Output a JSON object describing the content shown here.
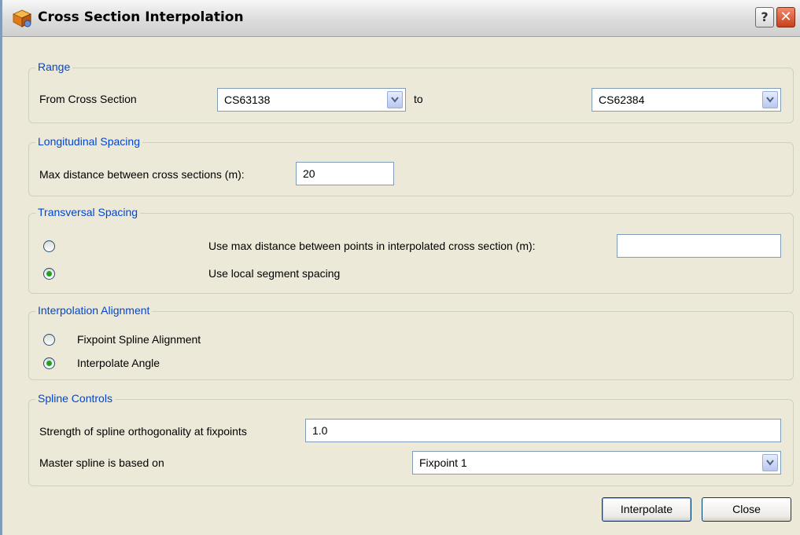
{
  "window": {
    "title": "Cross Section Interpolation",
    "help_label": "?",
    "close_label": "✕"
  },
  "range": {
    "legend": "Range",
    "from_label": "From Cross Section",
    "from_value": "CS63138",
    "to_label": "to",
    "to_value": "CS62384"
  },
  "longitudinal": {
    "legend": "Longitudinal Spacing",
    "max_distance_label": "Max distance between cross sections (m):",
    "max_distance_value": "20"
  },
  "transversal": {
    "legend": "Transversal Spacing",
    "option_max_label": "Use max distance between points in interpolated cross section (m):",
    "option_max_value": "",
    "option_local_label": "Use local segment spacing",
    "selected": "local"
  },
  "alignment": {
    "legend": "Interpolation Alignment",
    "option_fixpoint_label": "Fixpoint Spline Alignment",
    "option_angle_label": "Interpolate Angle",
    "selected": "angle"
  },
  "spline": {
    "legend": "Spline Controls",
    "strength_label": "Strength of spline orthogonality at fixpoints",
    "strength_value": "1.0",
    "master_label": "Master spline is based on",
    "master_value": "Fixpoint 1"
  },
  "buttons": {
    "interpolate_label": "Interpolate",
    "close_label": "Close"
  },
  "colors": {
    "legend": "#0046d5",
    "radio_selected": "#21a121",
    "close_button": "#c8401c"
  }
}
